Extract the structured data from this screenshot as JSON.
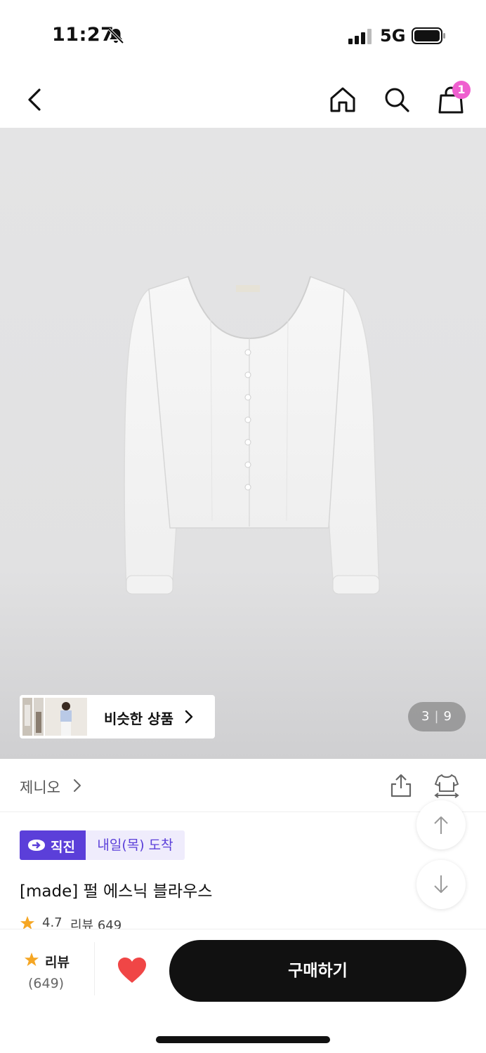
{
  "status_bar": {
    "time": "11:27",
    "network": "5G"
  },
  "nav": {
    "cart_count": "1"
  },
  "gallery": {
    "similar_label": "비슷한 상품",
    "page_current": "3",
    "page_separator": "|",
    "page_total": "9"
  },
  "brand": {
    "name": "제니오"
  },
  "tags": {
    "direct": "직진",
    "delivery": "내일(목) 도착"
  },
  "product": {
    "title": "[made] 펄 에스닉 블라우스",
    "rating": "4.7",
    "review_label": "리뷰 649"
  },
  "bottom_bar": {
    "review_label": "리뷰",
    "review_count": "(649)",
    "buy_label": "구매하기"
  },
  "colors": {
    "accent": "#5b3fd9",
    "badge": "#ef5fcf",
    "heart": "#f04646",
    "star": "#f5a623"
  }
}
